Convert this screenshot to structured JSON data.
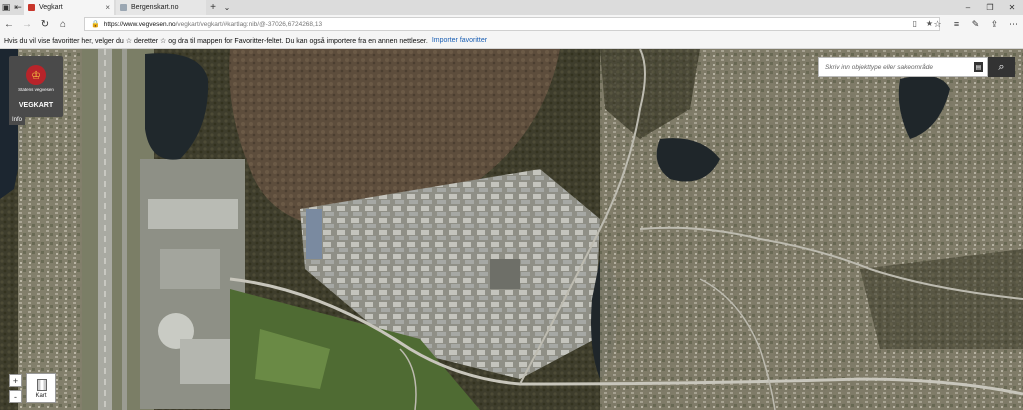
{
  "tabs": [
    {
      "title": "Vegkart",
      "active": true
    },
    {
      "title": "Bergenskart.no",
      "active": false
    }
  ],
  "address": {
    "host": "https://www.vegvesen.no",
    "path": "/vegkart/vegkart/#kartlag:nib/@-37026,6724268,13"
  },
  "favorites_bar": {
    "message": "Hvis du vil vise favoritter her, velger du  ☆  deretter ☆ og dra til mappen for Favoritter-feltet. Du kan også importere fra en annen nettleser.",
    "import_link": "Importer favoritter"
  },
  "map": {
    "logo_text": "Statens vegvesen",
    "app_title": "VEGKART",
    "info_label": "Info",
    "search_placeholder": "Skriv inn objekttype eller sakeområde",
    "zoom_in": "+",
    "zoom_out": "-",
    "basemap_label": "Kart"
  },
  "icons": {
    "back": "back-arrow-icon",
    "forward": "forward-arrow-icon",
    "refresh": "refresh-icon",
    "home": "home-icon",
    "search": "magnifier-icon"
  }
}
